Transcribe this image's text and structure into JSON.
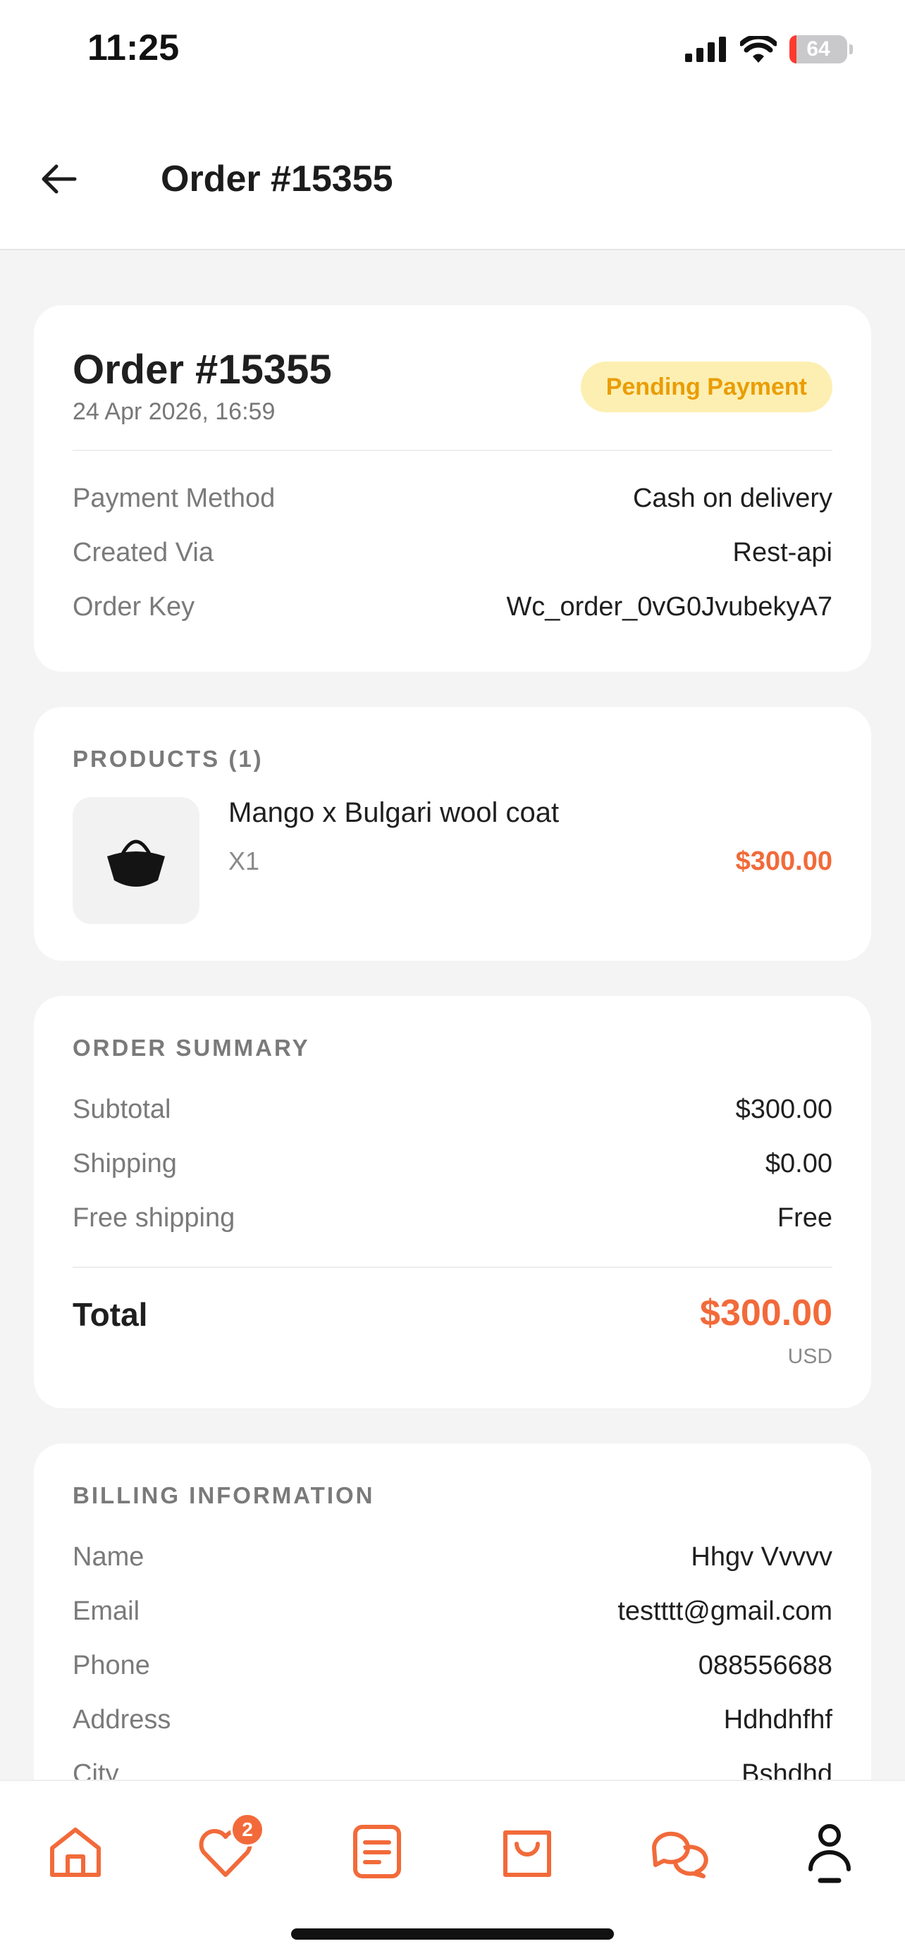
{
  "status_bar": {
    "time": "11:25",
    "battery": "64"
  },
  "header": {
    "title": "Order #15355"
  },
  "order": {
    "title": "Order #15355",
    "date": "24 Apr 2026, 16:59",
    "status": "Pending Payment",
    "rows": [
      {
        "label": "Payment Method",
        "value": "Cash on delivery"
      },
      {
        "label": "Created Via",
        "value": "Rest-api"
      },
      {
        "label": "Order Key",
        "value": "Wc_order_0vG0JvubekyA7"
      }
    ]
  },
  "products": {
    "title": "PRODUCTS (1)",
    "items": [
      {
        "name": "Mango x Bulgari wool coat",
        "qty": "X1",
        "price": "$300.00"
      }
    ]
  },
  "summary": {
    "title": "ORDER SUMMARY",
    "rows": [
      {
        "label": "Subtotal",
        "value": "$300.00"
      },
      {
        "label": "Shipping",
        "value": "$0.00"
      },
      {
        "label": "Free shipping",
        "value": "Free"
      }
    ],
    "total_label": "Total",
    "total_value": "$300.00",
    "currency": "USD"
  },
  "billing": {
    "title": "BILLING INFORMATION",
    "rows": [
      {
        "label": "Name",
        "value": "Hhgv Vvvvv"
      },
      {
        "label": "Email",
        "value": "testttt@gmail.com"
      },
      {
        "label": "Phone",
        "value": "088556688"
      },
      {
        "label": "Address",
        "value": "Hdhdhfhf"
      },
      {
        "label": "City",
        "value": "Bshdhd"
      }
    ]
  },
  "nav": {
    "wishlist_badge": "2",
    "items": [
      "home-icon",
      "heart-icon",
      "orders-icon",
      "shopping-bag-icon",
      "chat-icon",
      "profile-icon"
    ]
  },
  "colors": {
    "accent": "#f26a3a",
    "badge_bg": "#fdefb2",
    "badge_text": "#ea9d04"
  }
}
